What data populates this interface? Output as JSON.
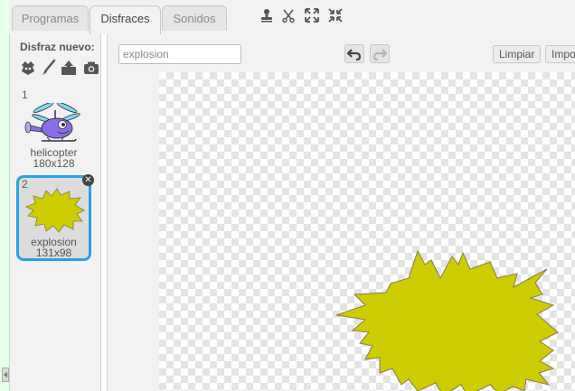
{
  "tabs": [
    {
      "label": "Programas"
    },
    {
      "label": "Disfraces"
    },
    {
      "label": "Sonidos"
    }
  ],
  "toolbar_icons": [
    "stamp-icon",
    "cut-icon",
    "grow-icon",
    "shrink-icon"
  ],
  "costume_panel": {
    "new_label": "Disfraz nuevo:",
    "new_icons": [
      "choose-from-library-icon",
      "paint-brush-icon",
      "upload-icon",
      "camera-icon"
    ],
    "costumes": [
      {
        "number": "1",
        "name": "helicopter",
        "dims": "180x128",
        "selected": false
      },
      {
        "number": "2",
        "name": "explosion",
        "dims": "131x98",
        "selected": true
      }
    ]
  },
  "editor": {
    "name_value": "explosion",
    "undo_icon": "undo-icon",
    "redo_icon": "redo-icon",
    "clear_label": "Limpiar",
    "import_label": "Importar"
  },
  "colors": {
    "accent": "#2aa1e8",
    "explosion_fill": "#cccc00",
    "helicopter": "#8a6ee8"
  }
}
